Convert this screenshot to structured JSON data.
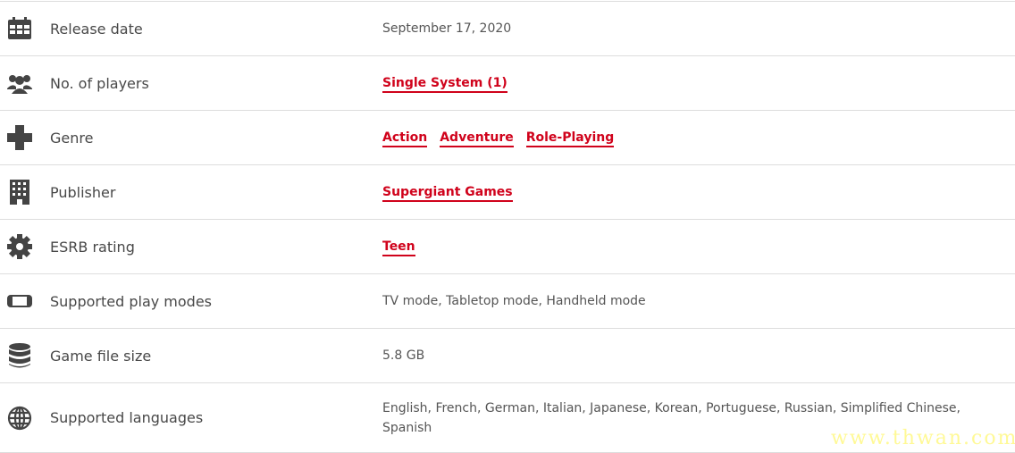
{
  "rows": [
    {
      "label": "Release date",
      "icon": "calendar-icon",
      "value": "September 17, 2020"
    },
    {
      "label": "No. of players",
      "icon": "users-icon",
      "links": [
        "Single System (1)"
      ]
    },
    {
      "label": "Genre",
      "icon": "dpad-icon",
      "links": [
        "Action",
        "Adventure",
        "Role-Playing"
      ]
    },
    {
      "label": "Publisher",
      "icon": "building-icon",
      "links": [
        "Supergiant Games"
      ]
    },
    {
      "label": "ESRB rating",
      "icon": "gear-icon",
      "links": [
        "Teen"
      ]
    },
    {
      "label": "Supported play modes",
      "icon": "console-icon",
      "value": "TV mode, Tabletop mode, Handheld mode"
    },
    {
      "label": "Game file size",
      "icon": "database-icon",
      "value": "5.8 GB"
    },
    {
      "label": "Supported languages",
      "icon": "globe-icon",
      "value": "English, French, German, Italian, Japanese, Korean, Portuguese, Russian, Simplified Chinese, Spanish"
    }
  ],
  "colors": {
    "link": "#d0021b",
    "text": "#484848"
  },
  "watermark": "www.thwan.com"
}
